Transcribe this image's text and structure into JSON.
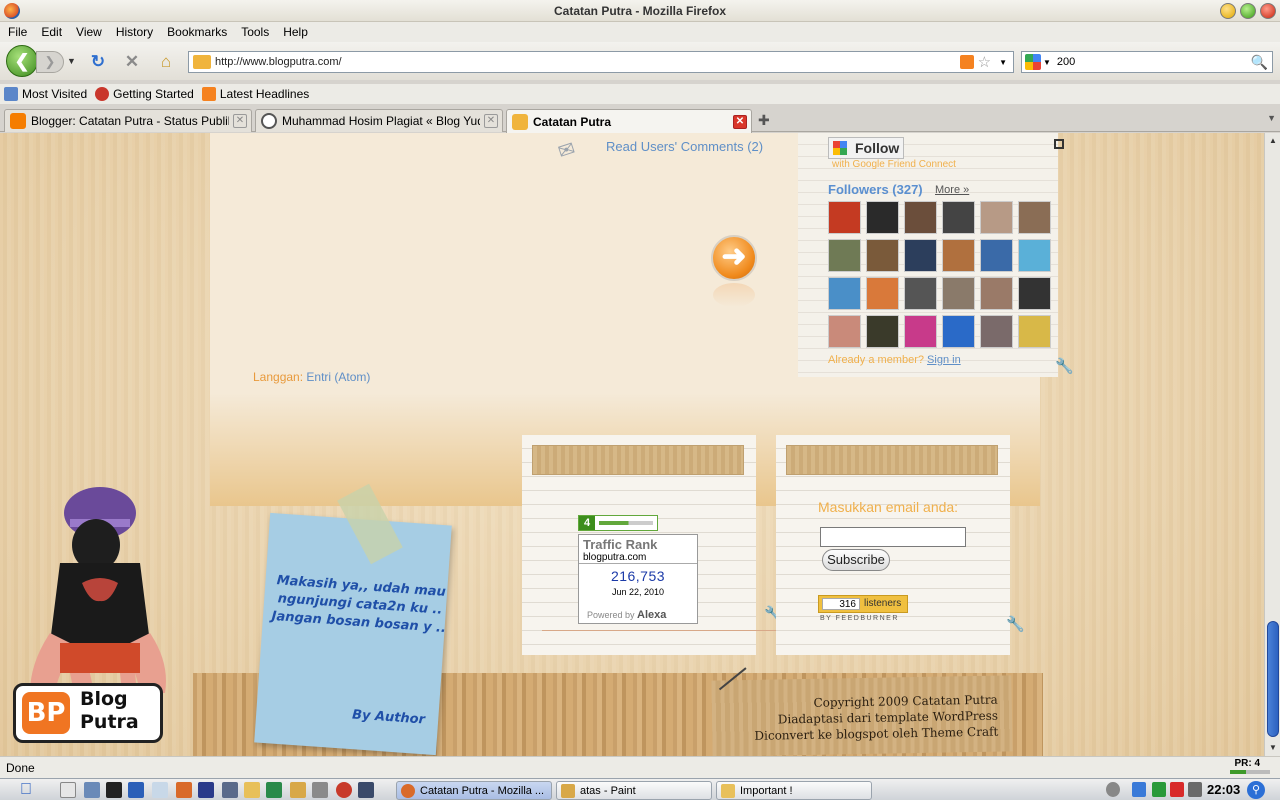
{
  "window": {
    "title": "Catatan Putra - Mozilla Firefox"
  },
  "menu": {
    "items": [
      "File",
      "Edit",
      "View",
      "History",
      "Bookmarks",
      "Tools",
      "Help"
    ]
  },
  "nav": {
    "back_icon": "back-arrow-icon",
    "forward_icon": "forward-arrow-icon",
    "url": "http://www.blogputra.com/",
    "search_value": "200"
  },
  "bookmarks": {
    "items": [
      "Most Visited",
      "Getting Started",
      "Latest Headlines"
    ]
  },
  "tabs": [
    {
      "label": "Blogger: Catatan Putra - Status Publikasi",
      "active": false
    },
    {
      "label": "Muhammad Hosim Plagiat « Blog Yudi ...",
      "active": false
    },
    {
      "label": "Catatan Putra",
      "active": true
    }
  ],
  "page": {
    "read_comments": "Read Users' Comments (2)",
    "subscribe_prefix": "Langgan: ",
    "subscribe_link": "Entri (Atom)",
    "follow": {
      "button": "Follow",
      "gfc_text": "with Google Friend Connect",
      "followers_title": "Followers (327)",
      "more_link": "More »",
      "member_text": "Already a member? ",
      "sign_in": "Sign in",
      "avatar_colors": [
        "#c43a22",
        "#2a2a2a",
        "#6b4e3b",
        "#444444",
        "#b79a86",
        "#8a6d55",
        "#6f7a55",
        "#7a5a3a",
        "#2c3e5c",
        "#b0703e",
        "#3a6aa8",
        "#5ab0d8",
        "#4a8fc8",
        "#d9793a",
        "#555555",
        "#8a7a6a",
        "#9a7a68",
        "#333333",
        "#c98a7a",
        "#3a3a2a",
        "#c83a8a",
        "#2a6ac8",
        "#7a6a6a",
        "#d8b848"
      ]
    },
    "alexa": {
      "badge_num": "4",
      "title": "Traffic Rank",
      "domain": "blogputra.com",
      "rank": "216,753",
      "date": "Jun 22, 2010",
      "powered": "Powered by",
      "brand": "Alexa"
    },
    "feedburner": {
      "email_label": "Masukkan email anda:",
      "subscribe_button": "Subscribe",
      "listeners_count": "316",
      "listeners_label": "listeners",
      "by": "BY FEEDBURNER"
    },
    "note": {
      "line1": "Makasih ya,, udah mau",
      "line2": "ngunjungi cata2n ku ..",
      "line3": "Jangan bosan bosan y ..",
      "by": "By Author"
    },
    "logo": {
      "mark": "BP",
      "line1": "Blog",
      "line2": "Putra"
    },
    "copyright": {
      "line1": "Copyright 2009 Catatan Putra",
      "line2": "Diadaptasi dari template WordPress",
      "line3": "Diconvert ke blogspot oleh Theme Craft"
    }
  },
  "status": {
    "text": "Done",
    "pr": "PR: 4"
  },
  "taskbar": {
    "tasks": [
      "Catatan Putra - Mozilla ...",
      "atas - Paint",
      "Important !"
    ],
    "clock": "22:03"
  }
}
